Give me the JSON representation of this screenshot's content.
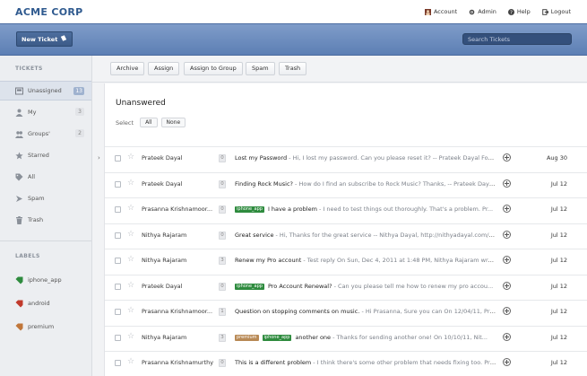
{
  "brand": "ACME CORP",
  "toplinks": [
    {
      "label": "Account",
      "icon": "account-icon"
    },
    {
      "label": "Admin",
      "icon": "gear-icon"
    },
    {
      "label": "Help",
      "icon": "help-icon"
    },
    {
      "label": "Logout",
      "icon": "logout-icon"
    }
  ],
  "header": {
    "new_ticket": "New Ticket",
    "search_placeholder": "Search Tickets"
  },
  "sidebar": {
    "tickets_title": "TICKETS",
    "items": [
      {
        "label": "Unassigned",
        "count": "13",
        "icon": "inbox-icon"
      },
      {
        "label": "My",
        "count": "3",
        "icon": "user-icon"
      },
      {
        "label": "Groups'",
        "count": "2",
        "icon": "group-icon"
      },
      {
        "label": "Starred",
        "count": "",
        "icon": "star-icon"
      },
      {
        "label": "All",
        "count": "",
        "icon": "tag-icon"
      },
      {
        "label": "Spam",
        "count": "",
        "icon": "spam-icon"
      },
      {
        "label": "Trash",
        "count": "",
        "icon": "trash-icon"
      }
    ],
    "labels_title": "LABELS",
    "labels": [
      {
        "label": "iphone_app",
        "color": "#2e8b3e"
      },
      {
        "label": "android",
        "color": "#c0392b"
      },
      {
        "label": "premium",
        "color": "#c0763a"
      }
    ]
  },
  "toolbar": {
    "buttons": [
      "Archive",
      "Assign",
      "Assign to Group",
      "Spam",
      "Trash"
    ]
  },
  "main": {
    "title": "Unanswered",
    "select_label": "Select",
    "select_all": "All",
    "select_none": "None"
  },
  "tickets": [
    {
      "name": "Prateek Dayal",
      "count": "0",
      "tags": [],
      "subject": "Lost my Password",
      "preview": " - Hi, I lost my password. Can you please reset it? -- Prateek Dayal Foun...",
      "date": "Aug 30"
    },
    {
      "name": "Prateek Dayal",
      "count": "0",
      "tags": [],
      "subject": "Finding Rock Music?",
      "preview": " - How do I find an subscribe to Rock Music? Thanks, -- Prateek Dayal Fo...",
      "date": "Jul 12"
    },
    {
      "name": "Prasanna Krishnamoor...",
      "count": "0",
      "tags": [
        "iphone_app"
      ],
      "subject": "I have a problem",
      "preview": " - I need to test things out thoroughly. That's a problem. Pr...",
      "date": "Jul 12"
    },
    {
      "name": "Nithya Rajaram",
      "count": "0",
      "tags": [],
      "subject": "Great service",
      "preview": " - Hi, Thanks for the great service -- Nithya Dayal, http://nithyadayal.com/blog",
      "date": "Jul 12"
    },
    {
      "name": "Nithya Rajaram",
      "count": "3",
      "tags": [],
      "subject": "Renew my Pro account",
      "preview": " - Test reply On Sun, Dec 4, 2011 at 1:48 PM, Nithya Rajaram wrote...",
      "date": "Jul 12"
    },
    {
      "name": "Prateek Dayal",
      "count": "0",
      "tags": [
        "iphone_app"
      ],
      "subject": "Pro Account Renewal?",
      "preview": " - Can you please tell me how to renew my pro accou...",
      "date": "Jul 12"
    },
    {
      "name": "Prasanna Krishnamoor...",
      "count": "1",
      "tags": [],
      "subject": "Question on stopping comments on music.",
      "preview": " - Hi Prasanna, Sure you can On 12/04/11, Pras...",
      "date": "Jul 12"
    },
    {
      "name": "Nithya Rajaram",
      "count": "3",
      "tags": [
        "premium",
        "iphone_app"
      ],
      "subject": "another one",
      "preview": " - Thanks for sending another one! On 10/10/11, Nit...",
      "date": "Jul 12"
    },
    {
      "name": "Prasanna Krishnamurthy",
      "count": "0",
      "tags": [],
      "subject": "This is a different problem",
      "preview": " - I think there's some other problem that needs fixing too. Pras...",
      "date": "Jul 12"
    }
  ]
}
